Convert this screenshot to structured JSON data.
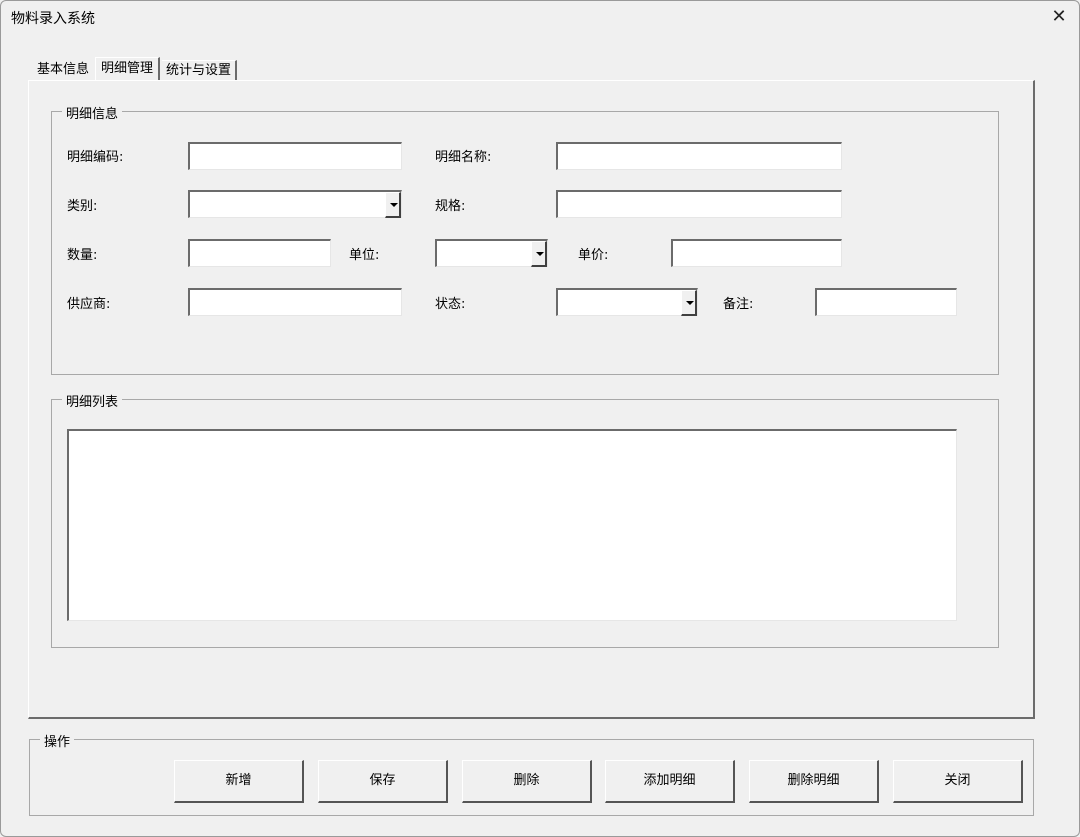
{
  "window": {
    "title": "物料录入系统",
    "close": "✕"
  },
  "tabs": [
    {
      "label": "基本信息"
    },
    {
      "label": "明细管理"
    },
    {
      "label": "统计与设置"
    }
  ],
  "detail_info": {
    "group_title": "明细信息",
    "fields": {
      "code": {
        "label": "明细编码:",
        "value": ""
      },
      "name": {
        "label": "明细名称:",
        "value": ""
      },
      "category": {
        "label": "类别:",
        "value": ""
      },
      "spec": {
        "label": "规格:",
        "value": ""
      },
      "quantity": {
        "label": "数量:",
        "value": ""
      },
      "unit": {
        "label": "单位:",
        "value": ""
      },
      "unit_price": {
        "label": "单价:",
        "value": ""
      },
      "supplier": {
        "label": "供应商:",
        "value": ""
      },
      "status": {
        "label": "状态:",
        "value": ""
      },
      "remark": {
        "label": "备注:",
        "value": ""
      }
    }
  },
  "detail_list": {
    "group_title": "明细列表",
    "items": []
  },
  "operations": {
    "group_title": "操作",
    "buttons": {
      "new": "新增",
      "save": "保存",
      "delete": "删除",
      "add_detail": "添加明细",
      "delete_detail": "删除明细",
      "close": "关闭"
    }
  },
  "icons": {
    "dropdown": "chevron-down-icon",
    "close": "close-icon"
  }
}
